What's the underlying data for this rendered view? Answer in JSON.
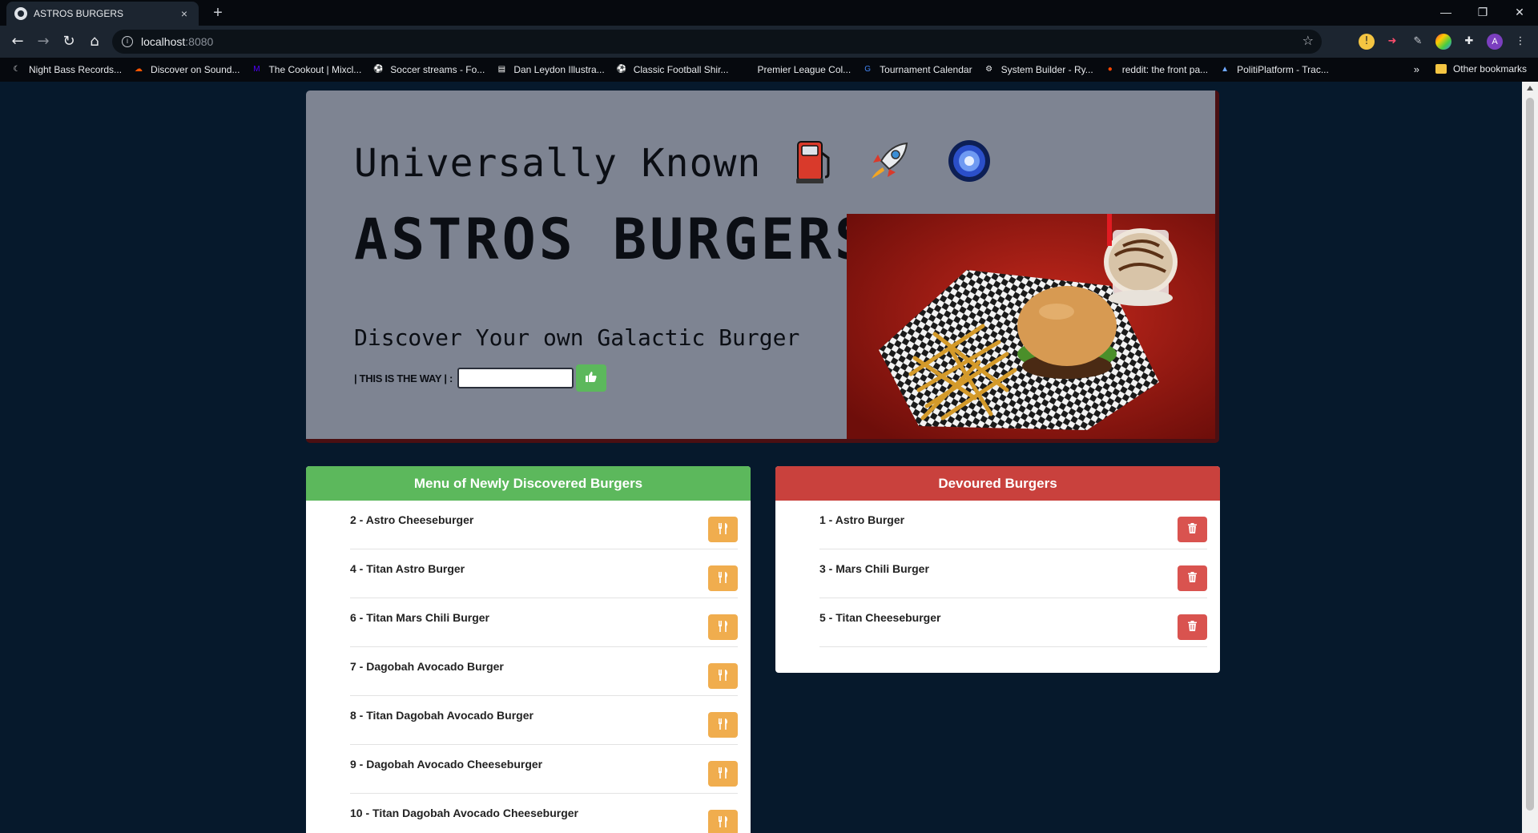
{
  "browser": {
    "tab_title": "ASTROS BURGERS",
    "tab_close": "×",
    "new_tab": "+",
    "url_host": "localhost",
    "url_port": ":8080",
    "window_controls": [
      "—",
      "❐",
      "✕"
    ],
    "bookmarks": [
      {
        "label": "Night Bass Records...",
        "icon": "moon-icon",
        "color": "#e8eaed"
      },
      {
        "label": "Discover on Sound...",
        "icon": "soundcloud-icon",
        "color": "#ff5500"
      },
      {
        "label": "The Cookout | Mixcl...",
        "icon": "mixcloud-icon",
        "color": "#5000ff"
      },
      {
        "label": "Soccer streams - Fo...",
        "icon": "soccer-ball-icon",
        "color": "#6a7cff"
      },
      {
        "label": "Dan Leydon Illustra...",
        "icon": "page-icon",
        "color": "#ffffff"
      },
      {
        "label": "Classic Football Shir...",
        "icon": "football-icon",
        "color": "#e8eaed"
      },
      {
        "label": "Premier League Col...",
        "icon": "blank-icon",
        "color": "#06090e"
      },
      {
        "label": "Tournament Calendar",
        "icon": "google-icon",
        "color": "#4285f4"
      },
      {
        "label": "System Builder - Ry...",
        "icon": "gear-icon",
        "color": "#e8eaed"
      },
      {
        "label": "reddit: the front pa...",
        "icon": "reddit-icon",
        "color": "#ff4500"
      },
      {
        "label": "PolitiPlatform - Trac...",
        "icon": "platform-icon",
        "color": "#6fa8ff"
      }
    ],
    "bookmarks_more": "»",
    "other_bookmarks": "Other bookmarks"
  },
  "hero": {
    "line1": "Universally Known",
    "emojis": [
      "fuel-pump-icon",
      "rocket-icon",
      "galaxy-icon"
    ],
    "title": "ASTROS BURGERS",
    "subtitle": "Discover Your own Galactic Burger",
    "form_label": "| THIS IS THE WAY | :",
    "input_value": "",
    "submit_icon": "thumbs-up-icon"
  },
  "menu_panel": {
    "heading": "Menu of Newly Discovered Burgers",
    "items": [
      "2 - Astro Cheeseburger",
      "4 - Titan Astro Burger",
      "6 - Titan Mars Chili Burger",
      "7 - Dagobah Avocado Burger",
      "8 - Titan Dagobah Avocado Burger",
      "9 - Dagobah Avocado Cheeseburger",
      "10 - Titan Dagobah Avocado Cheeseburger"
    ],
    "button_icon": "utensils-icon"
  },
  "devoured_panel": {
    "heading": "Devoured Burgers",
    "items": [
      "1 - Astro Burger",
      "3 - Mars Chili Burger",
      "5 - Titan Cheeseburger"
    ],
    "button_icon": "trash-icon"
  },
  "colors": {
    "page_bg": "#06192c",
    "jumbotron": "#7e8492",
    "menu_heading": "#5cb85c",
    "devoured_heading": "#c9413d",
    "devour_button": "#f0ad4e",
    "delete_button": "#d9534f"
  }
}
